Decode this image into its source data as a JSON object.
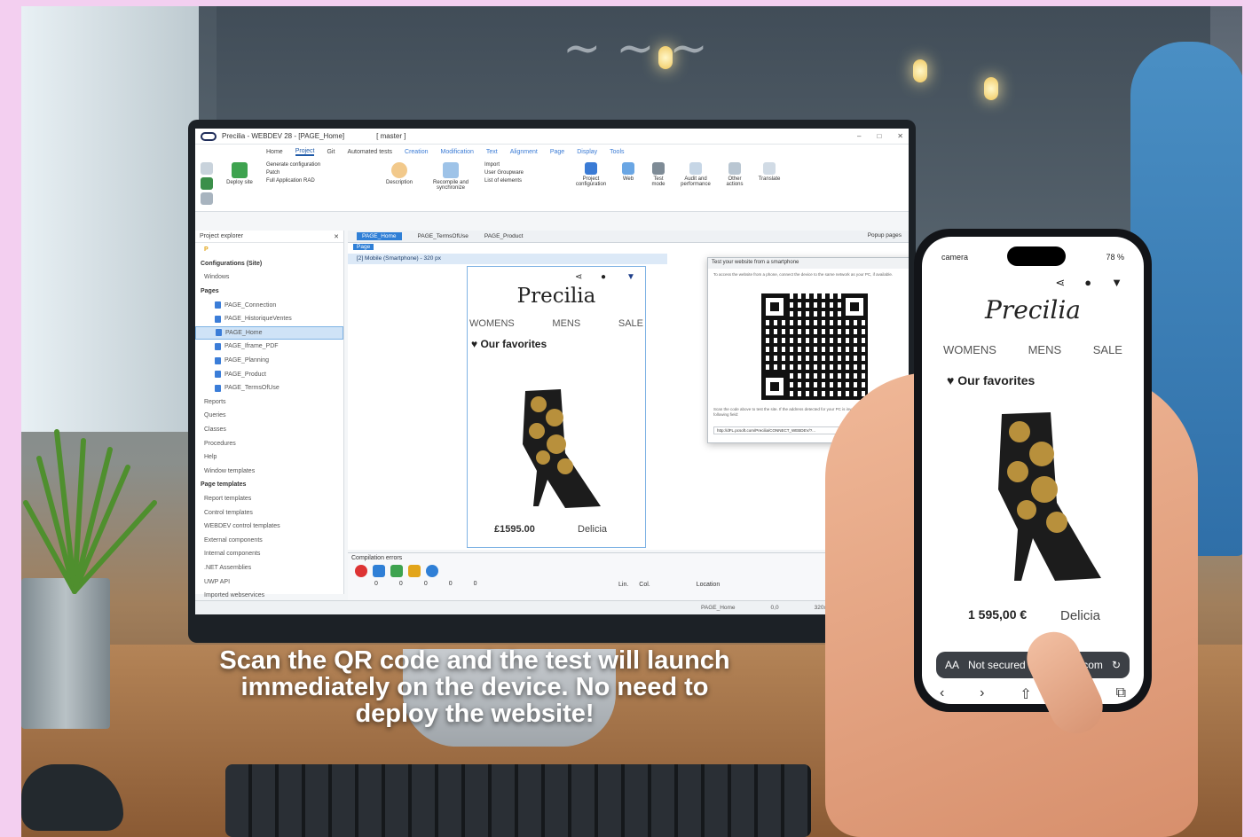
{
  "window": {
    "title": "Precilia - WEBDEV 28 - [PAGE_Home]",
    "branch": "[ master ]"
  },
  "menu_tabs": [
    "Home",
    "Project",
    "Git",
    "Automated tests",
    "Creation",
    "Modification",
    "Text",
    "Alignment",
    "Page",
    "Display",
    "Tools"
  ],
  "ribbon": {
    "generate_configuration": "Generate configuration",
    "patch": "Patch",
    "full_application_rad": "Full Application RAD",
    "deploy_site": "Deploy site",
    "description": "Description",
    "recompile": "Recompile and synchronize",
    "import": "Import",
    "user_groupware": "User Groupware",
    "list_of_elements": "List of elements",
    "project_configuration": "Project configuration",
    "web": "Web",
    "test_mode": "Test mode",
    "audit": "Audit and performance",
    "other_actions": "Other actions",
    "translate": "Translate"
  },
  "explorer": {
    "title": "Project explorer",
    "configurations": "Configurations (Site)",
    "windows": "Windows",
    "pages_label": "Pages",
    "pages": [
      "PAGE_Connection",
      "PAGE_HistoriqueVentes",
      "PAGE_Home",
      "PAGE_Iframe_PDF",
      "PAGE_Planning",
      "PAGE_Product",
      "PAGE_TermsOfUse"
    ],
    "other_sections": [
      "Reports",
      "Queries",
      "Classes",
      "Procedures",
      "Help",
      "Window templates"
    ],
    "page_templates": "Page templates",
    "template_items": [
      "Report templates",
      "Control templates",
      "WEBDEV control templates",
      "External components",
      "Internal components",
      ".NET Assemblies",
      "UWP API",
      "Imported webservices"
    ]
  },
  "editor": {
    "tabs": [
      "PAGE_Home",
      "PAGE_TermsOfUse",
      "PAGE_Product"
    ],
    "popup_pages": "Popup pages",
    "page_label": "Page",
    "device_label": "[2] Mobile (Smartphone) - 320 px",
    "brand": "Precilia",
    "nav": [
      "WOMENS",
      "MENS",
      "SALE"
    ],
    "favorites": "Our favorites",
    "price": "£1595.00",
    "product": "Delicia"
  },
  "qr_dialog": {
    "title": "Test your website from a smartphone",
    "instructions": "To access the website from a phone, connect the device to the same network as your PC, if available.",
    "note": "Scan the code above to test the site. If the address detected for your PC is invalid, you can change it in the following field:",
    "url": "http://dFL.pcsoft.com/Precilia/CONNECT_WEBDEV/?..."
  },
  "bottom_panel": {
    "title": "Compilation errors",
    "counts": [
      "0",
      "0",
      "0",
      "0",
      "0"
    ],
    "lin": "Lin.",
    "col": "Col.",
    "location": "Location"
  },
  "statusbar": {
    "page": "PAGE_Home",
    "coords": "0,0",
    "size": "320x"
  },
  "caption": "Scan the QR code and the test will launch immediately on the device. No need to deploy the website!",
  "phone": {
    "carrier": "camera",
    "battery": "78 %",
    "brand": "Precilia",
    "nav": [
      "WOMENS",
      "MENS",
      "SALE"
    ],
    "favorites": "Our favorites",
    "price": "1 595,00 €",
    "product": "Delicia",
    "aa": "AA",
    "not_secured": "Not secured",
    "domain": "psoft.com"
  },
  "colors": {
    "accent": "#2f7fd6",
    "qr_beam": "#f05a6e",
    "background": "#f3cff0"
  }
}
